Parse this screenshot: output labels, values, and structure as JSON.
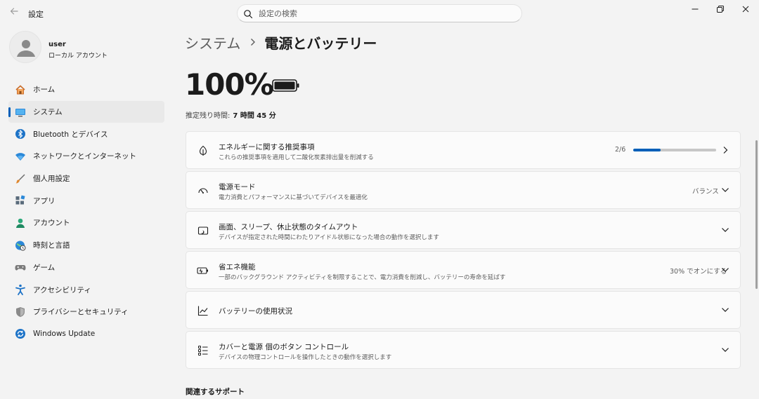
{
  "app": {
    "title": "設定",
    "search_placeholder": "設定の検索"
  },
  "profile": {
    "name": "user",
    "account_type": "ローカル アカウント"
  },
  "sidebar": {
    "items": [
      {
        "label": "ホーム",
        "icon": "home-icon"
      },
      {
        "label": "システム",
        "icon": "system-icon",
        "active": true
      },
      {
        "label": "Bluetooth とデバイス",
        "icon": "bluetooth-icon"
      },
      {
        "label": "ネットワークとインターネット",
        "icon": "network-icon"
      },
      {
        "label": "個人用設定",
        "icon": "brush-icon"
      },
      {
        "label": "アプリ",
        "icon": "apps-icon"
      },
      {
        "label": "アカウント",
        "icon": "accounts-icon"
      },
      {
        "label": "時刻と言語",
        "icon": "time-language-icon"
      },
      {
        "label": "ゲーム",
        "icon": "gamepad-icon"
      },
      {
        "label": "アクセシビリティ",
        "icon": "accessibility-icon"
      },
      {
        "label": "プライバシーとセキュリティ",
        "icon": "shield-icon"
      },
      {
        "label": "Windows Update",
        "icon": "update-icon"
      }
    ]
  },
  "breadcrumb": {
    "parent": "システム",
    "current": "電源とバッテリー"
  },
  "battery": {
    "percent": "100%",
    "estimate_label": "推定残り時間:",
    "estimate_value": "7 時間 45 分"
  },
  "cards": [
    {
      "title": "エネルギーに関する推奨事項",
      "desc": "これらの推奨事項を適用して二酸化炭素排出量を削減する",
      "value": "2/6",
      "progress": 0.333,
      "icon": "leaf-icon",
      "chevron": "chevron-right-icon"
    },
    {
      "title": "電源モード",
      "desc": "電力消費とパフォーマンスに基づいてデバイスを最適化",
      "value": "バランス",
      "icon": "power-mode-icon",
      "chevron": "chevron-down-icon"
    },
    {
      "title": "画面、スリープ、休止状態のタイムアウト",
      "desc": "デバイスが指定された時間にわたりアイドル状態になった場合の動作を選択します",
      "icon": "screen-sleep-icon",
      "chevron": "chevron-down-icon"
    },
    {
      "title": "省エネ機能",
      "desc": "一部のバックグラウンド アクティビティを制限することで、電力消費を削減し、バッテリーの寿命を延ばす",
      "value": "30% でオンにする",
      "icon": "battery-saver-icon",
      "chevron": "chevron-down-icon"
    },
    {
      "title": "バッテリーの使用状況",
      "icon": "usage-chart-icon",
      "chevron": "chevron-down-icon"
    },
    {
      "title": "カバーと電源 個のボタン コントロール",
      "desc": "デバイスの物理コントロールを操作したときの動作を選択します",
      "icon": "buttons-list-icon",
      "chevron": "chevron-down-icon"
    }
  ],
  "related_support": {
    "title": "関連するサポート"
  },
  "colors": {
    "accent": "#005fb8",
    "background": "#f3f3f3",
    "card": "#fbfbfb"
  }
}
